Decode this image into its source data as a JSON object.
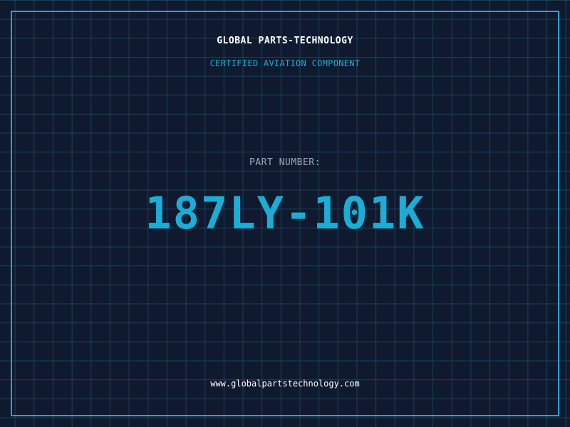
{
  "header": {
    "company": "GLOBAL PARTS-TECHNOLOGY",
    "subtitle": "CERTIFIED AVIATION COMPONENT"
  },
  "part": {
    "label": "PART NUMBER:",
    "number": "187LY-101K"
  },
  "footer": {
    "website": "www.globalpartstechnology.com"
  },
  "colors": {
    "background": "#101a2e",
    "grid": "#1c6080",
    "accent": "#1aa9d4",
    "label": "#9aa6b8",
    "text": "#ffffff"
  }
}
